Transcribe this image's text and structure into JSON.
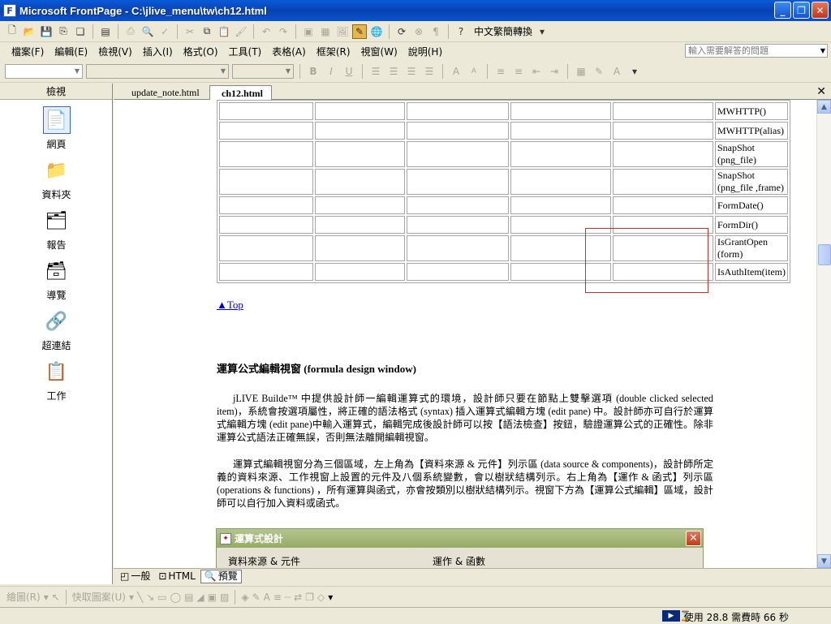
{
  "window": {
    "title": "Microsoft FrontPage - C:\\jlive_menu\\tw\\ch12.html"
  },
  "toolbar": {
    "zh_convert_label": "中文繁簡轉換"
  },
  "menubar": {
    "items": [
      "檔案(F)",
      "編輯(E)",
      "檢視(V)",
      "插入(I)",
      "格式(O)",
      "工具(T)",
      "表格(A)",
      "框架(R)",
      "視窗(W)",
      "說明(H)"
    ],
    "help_placeholder": "輸入需要解答的問題"
  },
  "sidebar": {
    "title": "檢視",
    "items": [
      {
        "label": "網頁",
        "icon": "page-icon"
      },
      {
        "label": "資料夾",
        "icon": "folder-icon"
      },
      {
        "label": "報告",
        "icon": "report-icon"
      },
      {
        "label": "導覽",
        "icon": "navigation-icon"
      },
      {
        "label": "超連結",
        "icon": "hyperlink-icon"
      },
      {
        "label": "工作",
        "icon": "task-icon"
      }
    ]
  },
  "tabs": [
    {
      "label": "update_note.html",
      "active": false
    },
    {
      "label": "ch12.html",
      "active": true
    }
  ],
  "document": {
    "table_rows": [
      "MWHTTP()",
      "MWHTTP(alias)",
      "SnapShot\n(png_file)",
      "SnapShot\n(png_file ,frame)",
      "FormDate()",
      "FormDir()",
      "IsGrantOpen\n(form)",
      "IsAuthItem(item)"
    ],
    "top_link": "▲Top",
    "heading": "運算公式編輯視窗 (formula design window)",
    "paragraph1": "jLIVE Builde™ 中提供設計師一編輯運算式的環境，設計師只要在節點上雙擊選項 (double clicked selected item)，系統會按選項屬性，將正確的語法格式 (syntax) 插入運算式編輯方塊 (edit pane) 中。設計師亦可自行於運算式編輯方塊 (edit pane)中輸入運算式，編輯完成後設計師可以按【語法檢查】按鈕，驗證運算公式的正確性。除非運算公式語法正確無誤，否則無法離開編輯視窗。",
    "paragraph2": "運算式編輯視窗分為三個區域，左上角為【資料來源 & 元件】列示區 (data source & components)，設計師所定義的資料來源、工作視窗上設置的元件及八個系統變數，會以樹狀結構列示。右上角為【運作 & 函式】列示區 (operations & functions) ，所有運算與函式，亦會按類別以樹狀結構列示。視窗下方為【運算公式編輯】區域，設計師可以自行加入資料或函式。",
    "dialog": {
      "title": "運算式設計",
      "panel_left": "資料來源 & 元件",
      "panel_right": "運作 & 函數"
    }
  },
  "viewbar": {
    "tabs": [
      "一般",
      "HTML",
      "預覽"
    ],
    "active": "預覽"
  },
  "drawbar": {
    "draw_label": "繪圖(R)",
    "autoshape_label": "快取圖案(U)"
  },
  "status": {
    "text": "使用 28.8 需費時 66 秒"
  }
}
